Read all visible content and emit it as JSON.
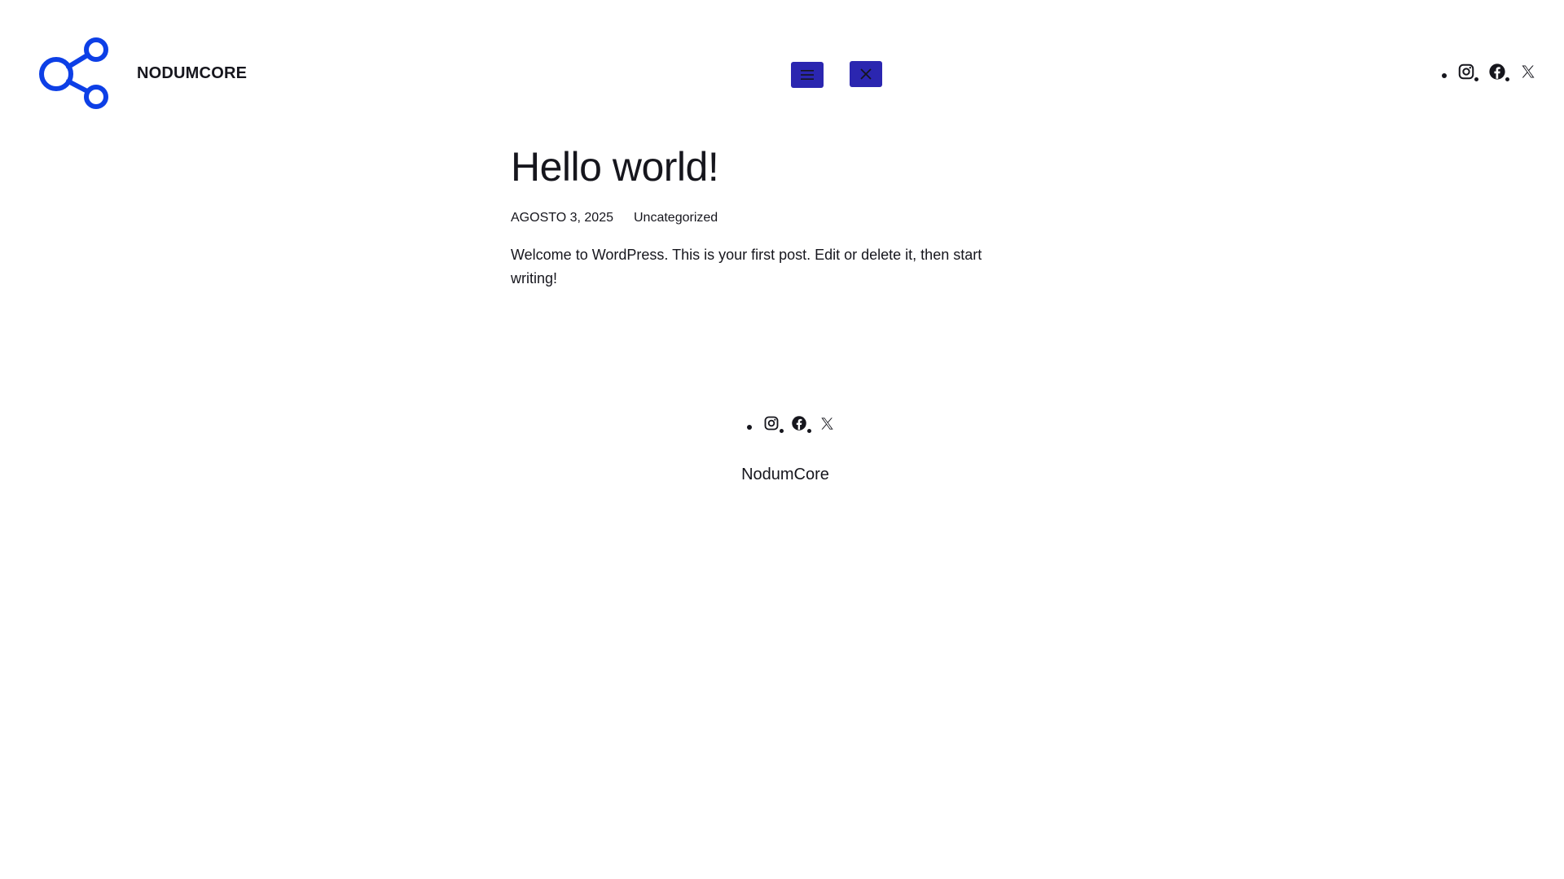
{
  "header": {
    "site_title": "NODUMCORE",
    "logo_icon": "network-share-icon",
    "open_menu_icon": "hamburger-menu-icon",
    "close_menu_icon": "close-x-icon",
    "button_color": "#2b26b0",
    "logo_color": "#0d3fe6",
    "social": [
      "instagram-icon",
      "facebook-icon",
      "x-twitter-icon"
    ]
  },
  "post": {
    "title": "Hello world!",
    "date": "AGOSTO 3, 2025",
    "category": "Uncategorized",
    "content": "Welcome to WordPress. This is your first post. Edit or delete it, then start writing!"
  },
  "footer": {
    "social": [
      "instagram-icon",
      "facebook-icon",
      "x-twitter-icon"
    ],
    "site_name": "NodumCore"
  }
}
